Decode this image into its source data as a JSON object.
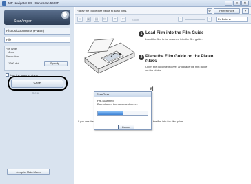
{
  "window": {
    "title": "MP Navigator EX - CanoScan 5600F",
    "controls": [
      "–",
      "□",
      "✕"
    ]
  },
  "left_panel": {
    "header": "Scan/Import",
    "mode_select": "Photos/Documents (Platen)",
    "file_label": "File",
    "settings": {
      "file_type_label": "File Type:",
      "file_type_value": "Auto",
      "resolution_label": "Resolution:",
      "resolution_value": "1200 dpi",
      "specify_label": "Specify..."
    },
    "scanner_driver_label": "Use the scanner driver",
    "scan_button": "Scan",
    "clear_label": "Clear",
    "jump_button": "Jump to Main Menu"
  },
  "main": {
    "instruction": "Follow the procedure below to scan films.",
    "preferences_label": "Preferences",
    "help_label": "?",
    "toolbar_icons": [
      "folder",
      "copy",
      "print",
      "mail",
      "crop",
      "trim"
    ],
    "zoom_label": "Zoom",
    "view_select": "Ex Date ▲",
    "steps": [
      {
        "num": "1",
        "title": "Load Film into the Film Guide",
        "desc": "Load the film to be scanned into the film guide."
      },
      {
        "num": "2",
        "title": "Place the Film Guide on the Platen",
        "title2": "Glass",
        "desc": "Open the document cover and place the film guide",
        "desc2": "on the platen."
      }
    ],
    "step3_partial": "r]",
    "hint_text": "If you use the",
    "hint_text2": "the film into the film guide."
  },
  "dialog": {
    "title": "ScanGear",
    "line1": "Pre-scanning",
    "line2": "Do not open the document cover.",
    "progress": 0.5,
    "cancel_label": "Cancel"
  }
}
